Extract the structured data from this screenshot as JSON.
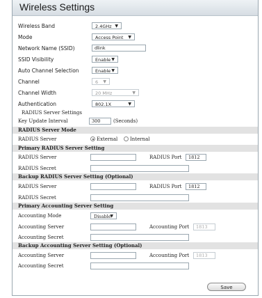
{
  "header": {
    "title": "Wireless Settings"
  },
  "wireless": {
    "band_label": "Wireless Band",
    "band_value": "2.4GHz",
    "mode_label": "Mode",
    "mode_value": "Access Point",
    "ssid_label": "Network Name (SSID)",
    "ssid_value": "dlink",
    "visibility_label": "SSID Visibility",
    "visibility_value": "Enable",
    "auto_channel_label": "Auto Channel Selection",
    "auto_channel_value": "Enable",
    "channel_label": "Channel",
    "channel_value": "6",
    "width_label": "Channel Width",
    "width_value": "20 MHz",
    "auth_label": "Authentication",
    "auth_value": "802.1X"
  },
  "radius": {
    "settings_title": "RADIUS Server Settings",
    "key_interval_label": "Key Update Interval",
    "key_interval_value": "300",
    "key_interval_unit": "(Seconds)",
    "mode_section": "RADIUS Server Mode",
    "server_label": "RADIUS Server",
    "external_label": "External",
    "internal_label": "Internal",
    "primary_section": "Primary RADIUS Server Setting",
    "primary_server_label": "RADIUS Server",
    "primary_port_label": "RADIUS Port",
    "primary_port_value": "1812",
    "primary_secret_label": "RADIUS Secret",
    "backup_section": "Backup RADIUS Server Setting (Optional)",
    "backup_server_label": "RADIUS Server",
    "backup_port_label": "RADIUS Port",
    "backup_port_value": "1812",
    "backup_secret_label": "RADIUS Secret"
  },
  "accounting": {
    "primary_section": "Primary Accounting Server Setting",
    "mode_label": "Accounting Mode",
    "mode_value": "Disable",
    "server_label": "Accounting Server",
    "port_label": "Accounting Port",
    "port_value": "1813",
    "secret_label": "Accounting Secret",
    "backup_section": "Backup Accounting Server Setting (Optional)",
    "backup_server_label": "Accounting Server",
    "backup_port_label": "Accounting Port",
    "backup_port_value": "1813",
    "backup_secret_label": "Accounting Secret"
  },
  "actions": {
    "save_label": "Save"
  }
}
